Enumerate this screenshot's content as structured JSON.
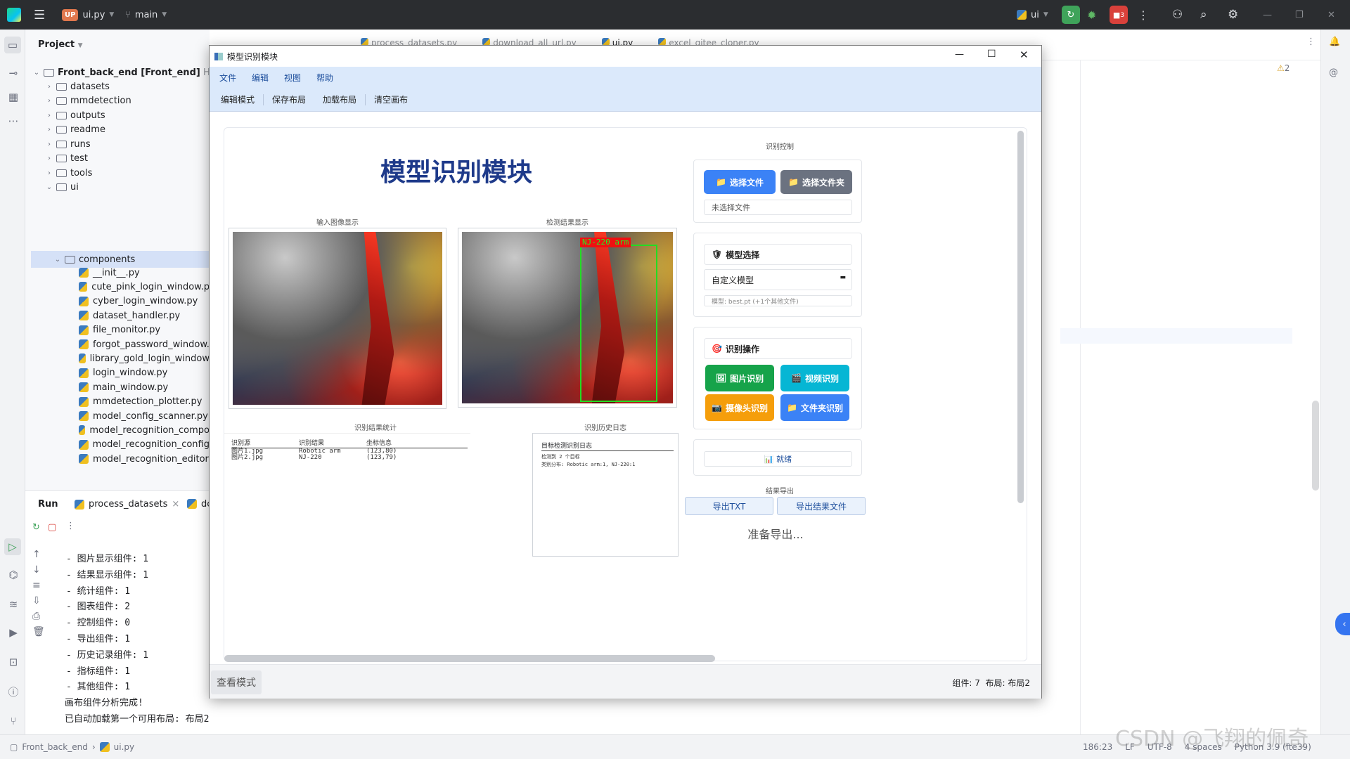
{
  "ide": {
    "project_badge": "UP",
    "file_name": "ui.py",
    "branch": "main",
    "run_config": "ui",
    "notification_count": "3",
    "project_label": "Project",
    "warnings": "2",
    "tree": {
      "root": "Front_back_end [Front_end]",
      "root_path": "H:\\Mo",
      "folders": [
        "datasets",
        "mmdetection",
        "outputs",
        "readme",
        "runs",
        "test",
        "tools",
        "ui"
      ],
      "subfolder": "components",
      "files": [
        "__init__.py",
        "cute_pink_login_window.p",
        "cyber_login_window.py",
        "dataset_handler.py",
        "file_monitor.py",
        "forgot_password_window.",
        "library_gold_login_window",
        "login_window.py",
        "main_window.py",
        "mmdetection_plotter.py",
        "model_config_scanner.py",
        "model_recognition_compo",
        "model_recognition_config",
        "model_recognition_editor"
      ]
    },
    "run": {
      "label": "Run",
      "tab1": "process_datasets",
      "tab2": "dc",
      "log": [
        "- 图片显示组件: 1",
        "- 结果显示组件: 1",
        "- 统计组件: 1",
        "- 图表组件: 2",
        "- 控制组件: 0",
        "- 导出组件: 1",
        "- 历史记录组件: 1",
        "- 指标组件: 1",
        "- 其他组件: 1",
        "画布组件分析完成!",
        "已自动加载第一个可用布局: 布局2"
      ]
    },
    "editor_tabs": [
      "process_datasets.py",
      "download_all_url.py",
      "ui.py",
      "excel_gitee_cloner.py"
    ],
    "status": {
      "breadcrumb1": "Front_back_end",
      "breadcrumb2": "ui.py",
      "position": "186:23",
      "line_sep": "LF",
      "encoding": "UTF-8",
      "indent": "4 spaces",
      "interpreter": "Python 3.9 (fte39)"
    },
    "watermark": "CSDN @飞翔的佩奇"
  },
  "app": {
    "window_title": "模型识别模块",
    "menu": [
      "文件",
      "编辑",
      "视图",
      "帮助"
    ],
    "toolbar": [
      "编辑模式",
      "保存布局",
      "加载布局",
      "清空画布"
    ],
    "heading": "模型识别模块",
    "input_caption": "输入图像显示",
    "result_caption": "检测结果显示",
    "detect_label": "NJ-220 arm",
    "stats_caption": "识别结果统计",
    "stats_headers": [
      "识别源",
      "识别结果",
      "坐标信息"
    ],
    "stats_rows": [
      [
        "图片1.jpg",
        "Robotic arm",
        "(123,80)"
      ],
      [
        "图片2.jpg",
        "NJ-220",
        "(123,79)"
      ]
    ],
    "history_caption": "识别历史日志",
    "history_title": "目标检测识别日志",
    "history_lines": [
      "检测到 2 个目标",
      "类别分布: Robotic arm:1, NJ-220:1"
    ],
    "control_caption": "识别控制",
    "select_file": "选择文件",
    "select_folder": "选择文件夹",
    "no_file": "未选择文件",
    "model_section": "模型选择",
    "model_value": "自定义模型",
    "model_info": "模型: best.pt (+1个其他文件)",
    "ops_section": "识别操作",
    "btn_image": "图片识别",
    "btn_video": "视频识别",
    "btn_camera": "摄像头识别",
    "btn_folder": "文件夹识别",
    "ready": "就绪",
    "export_caption": "结果导出",
    "export_txt": "导出TXT",
    "export_file": "导出结果文件",
    "export_status": "准备导出...",
    "view_mode": "查看模式",
    "footer_status": "组件: 7  布局: 布局2",
    "colors": {
      "blue": "#3b82f6",
      "gray": "#6b7280",
      "green": "#16a34a",
      "cyan": "#06b6d4",
      "orange": "#f59e0b",
      "heading": "#1e3a8a"
    }
  }
}
